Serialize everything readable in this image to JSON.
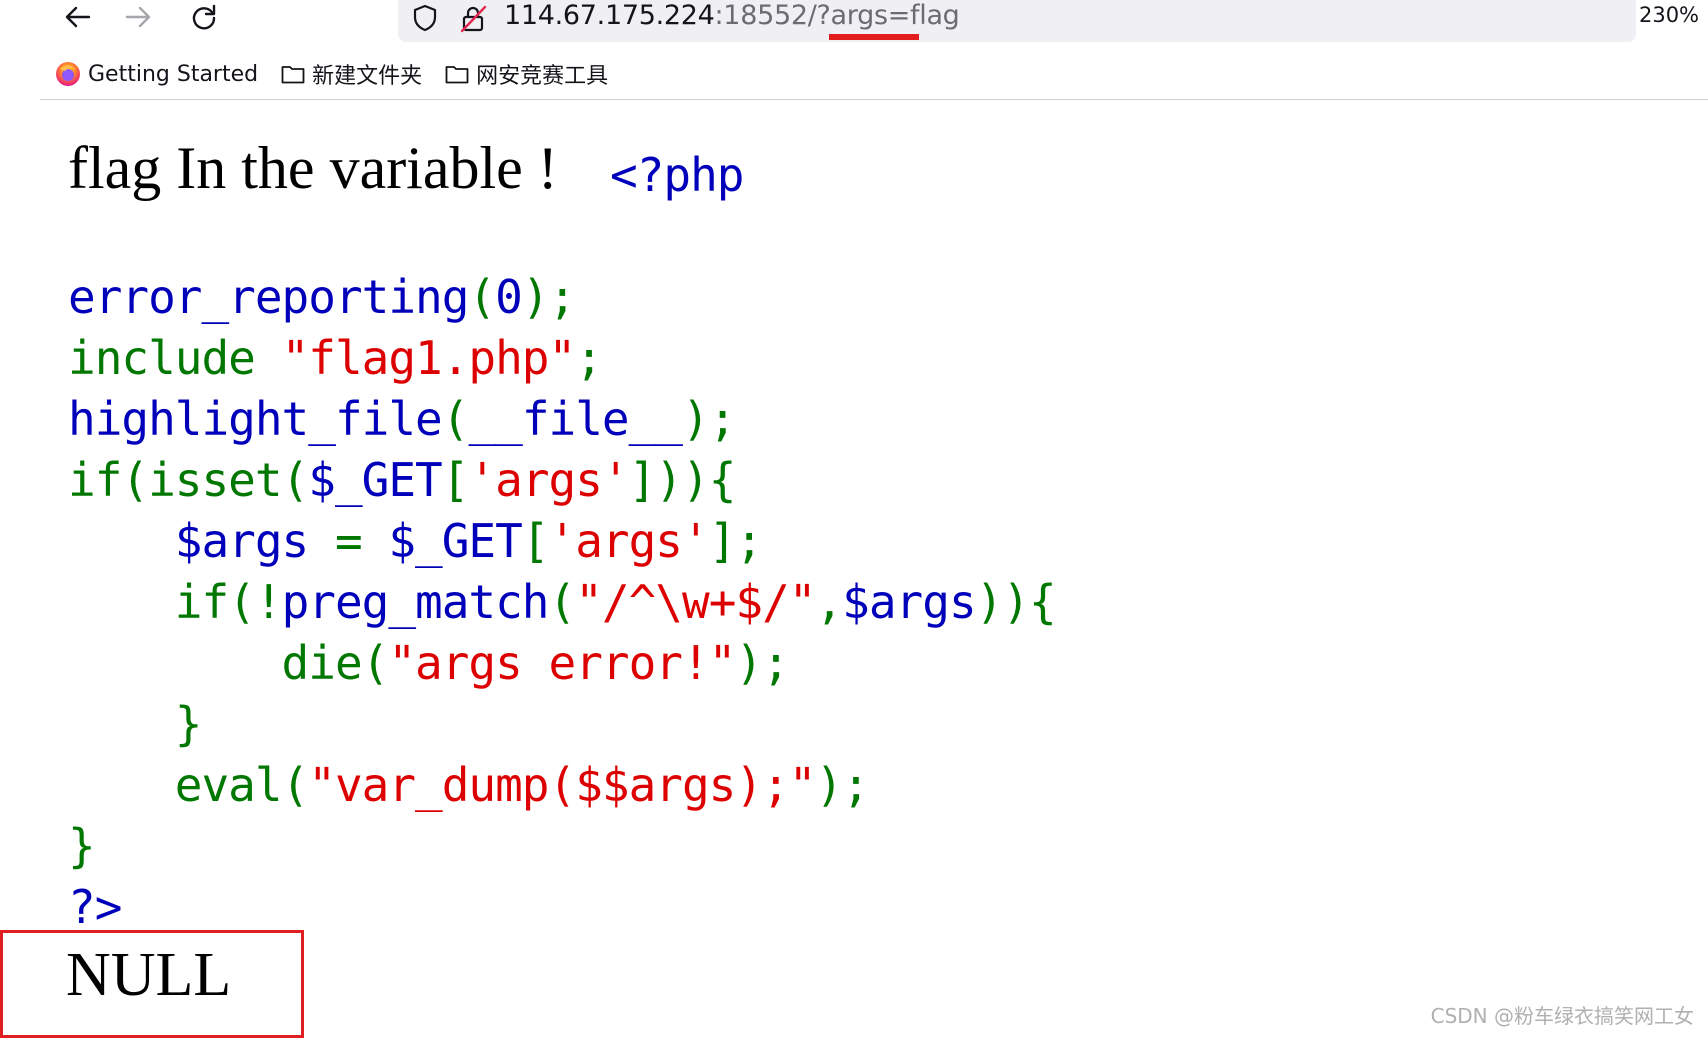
{
  "browser": {
    "url_host": "114.67.175.224",
    "url_rest": ":18552/?args=",
    "url_param_value": "flag",
    "zoom": "230%",
    "bookmarks": [
      {
        "label": "Getting Started",
        "icon": "firefox-icon"
      },
      {
        "label": "新建文件夹",
        "icon": "folder-icon"
      },
      {
        "label": "网安竞赛工具",
        "icon": "folder-icon"
      }
    ]
  },
  "page": {
    "headline": "flag In the variable !",
    "code": {
      "php_open": "<?php",
      "lines": {
        "l1_fn": "error_reporting",
        "l1_open": "(",
        "l1_arg": "0",
        "l1_close": ");",
        "l2_kw": "include ",
        "l2_str": "\"flag1.php\"",
        "l2_semi": ";",
        "l3_fn": "highlight_file",
        "l3_open": "(",
        "l3_arg": "__file__",
        "l3_close": ");",
        "l4_kw": "if(isset(",
        "l4_var": "$_GET",
        "l4_b": "[",
        "l4_str": "'args'",
        "l4_end": "])){",
        "l5_var": "    $args ",
        "l5_eq": "= ",
        "l5_get": "$_GET",
        "l5_b": "[",
        "l5_str": "'args'",
        "l5_end": "];",
        "l6_kw": "    if(!",
        "l6_fn": "preg_match",
        "l6_open": "(",
        "l6_str": "\"/^\\w+$/\"",
        "l6_comma": ",",
        "l6_var": "$args",
        "l6_end": ")){",
        "l7_kw": "        die(",
        "l7_str": "\"args error!\"",
        "l7_end": ");",
        "l8": "    }",
        "l9_kw": "    eval(",
        "l9_str": "\"var_dump($$args);\"",
        "l9_end": ");",
        "l10": "}",
        "php_close": "?>"
      }
    },
    "output": "NULL"
  },
  "watermark": "CSDN @粉车绿衣搞笑网工女",
  "colors": {
    "php_default": "#0000bb",
    "php_keyword": "#007700",
    "php_string": "#dd0000",
    "highlight_box": "#e02020"
  }
}
